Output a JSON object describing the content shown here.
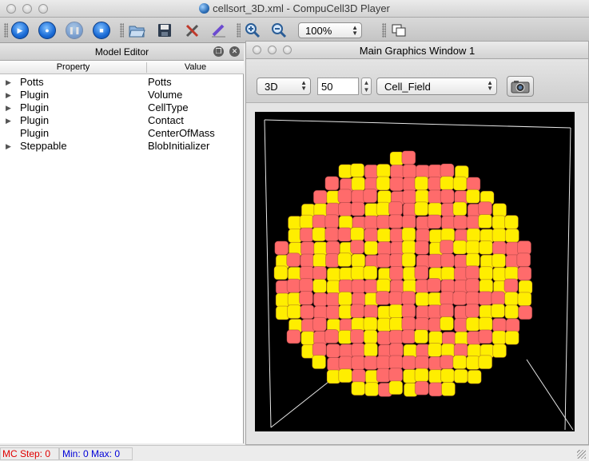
{
  "window": {
    "title": "cellsort_3D.xml - CompuCell3D Player"
  },
  "toolbar": {
    "buttons": [
      "run-icon",
      "step-icon",
      "pause-icon",
      "stop-icon",
      "open-file-icon",
      "save-icon",
      "tools-icon",
      "edit-icon",
      "zoom-in-icon",
      "zoom-out-icon",
      "tile-windows-icon"
    ],
    "zoom_value": "100%"
  },
  "model_editor": {
    "title": "Model Editor",
    "columns": {
      "property": "Property",
      "value": "Value"
    },
    "rows": [
      {
        "property": "Potts",
        "value": "Potts",
        "expandable": true
      },
      {
        "property": "Plugin",
        "value": "Volume",
        "expandable": true
      },
      {
        "property": "Plugin",
        "value": "CellType",
        "expandable": true
      },
      {
        "property": "Plugin",
        "value": "Contact",
        "expandable": true
      },
      {
        "property": "Plugin",
        "value": "CenterOfMass",
        "expandable": false
      },
      {
        "property": "Steppable",
        "value": "BlobInitializer",
        "expandable": true
      }
    ]
  },
  "graphics_window": {
    "title": "Main Graphics Window 1",
    "view_mode": "3D",
    "slice_value": "50",
    "field": "Cell_Field",
    "colors": {
      "cell_a": "#ff6b6b",
      "cell_b": "#ffee00",
      "background": "#000000"
    }
  },
  "status": {
    "mc_step": "MC Step: 0",
    "min_max": "Min: 0 Max: 0"
  }
}
